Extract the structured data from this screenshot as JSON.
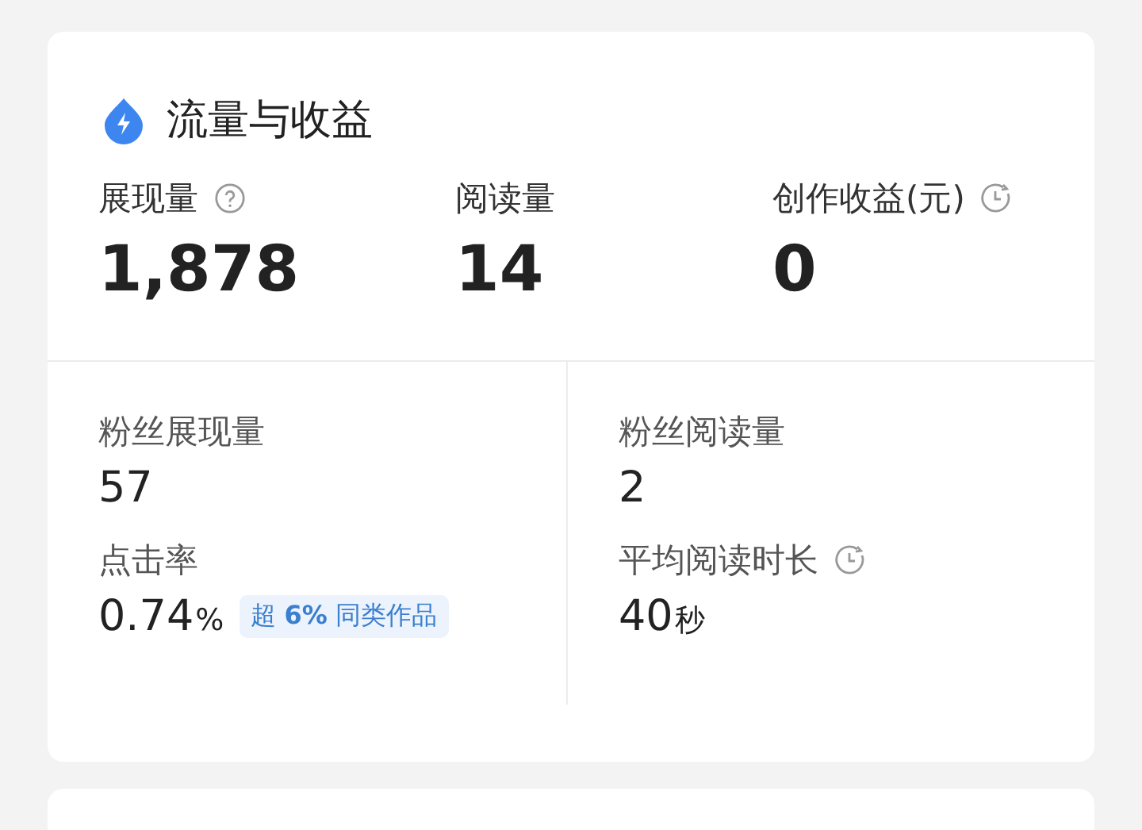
{
  "card": {
    "title": "流量与收益"
  },
  "top_metrics": [
    {
      "kind": "help",
      "label": "展现量",
      "value": "1,878"
    },
    {
      "kind": "plain",
      "label": "阅读量",
      "value": "14"
    },
    {
      "kind": "timed",
      "label": "创作收益(元)",
      "value": "0"
    }
  ],
  "detail_metrics": [
    {
      "kind": "plain",
      "label": "粉丝展现量",
      "value": "57"
    },
    {
      "kind": "plain",
      "label": "粉丝阅读量",
      "value": "2"
    },
    {
      "kind": "plain",
      "label": "点击率",
      "value": "0.74",
      "unit": "%",
      "badge": "超 **6%** 同类作品"
    },
    {
      "kind": "timed",
      "label": "平均阅读时长",
      "value": "40",
      "unit": "秒"
    }
  ]
}
